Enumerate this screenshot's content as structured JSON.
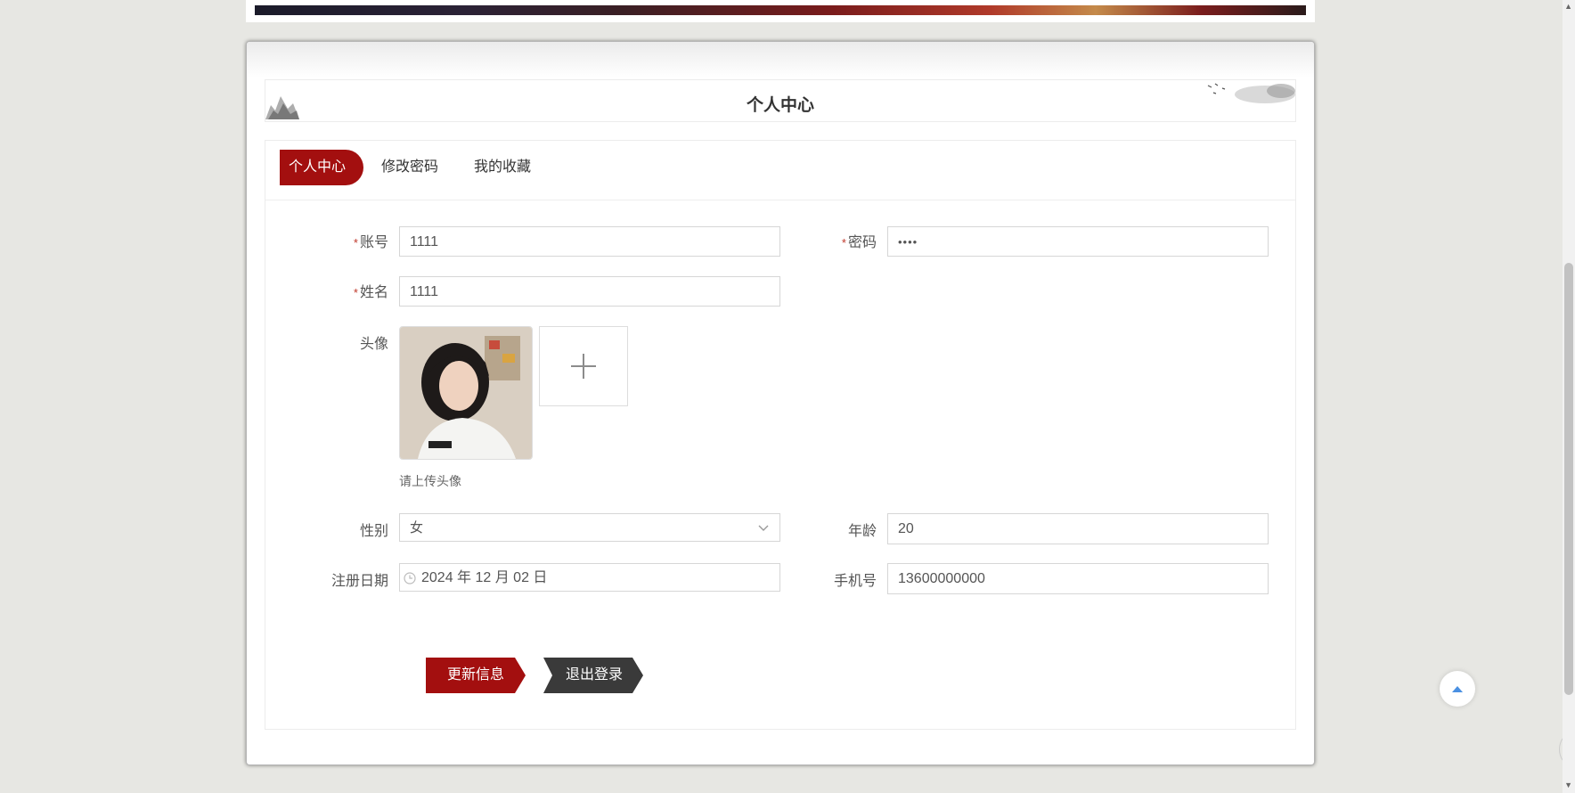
{
  "header": {
    "title": "个人中心"
  },
  "tabs": [
    {
      "label": "个人中心",
      "active": true
    },
    {
      "label": "修改密码",
      "active": false
    },
    {
      "label": "我的收藏",
      "active": false
    }
  ],
  "form": {
    "account": {
      "label": "账号",
      "required": "*",
      "value": "1111"
    },
    "password": {
      "label": "密码",
      "required": "*",
      "value": "••••"
    },
    "name": {
      "label": "姓名",
      "required": "*",
      "value": "1111"
    },
    "avatar": {
      "label": "头像",
      "hint": "请上传头像"
    },
    "gender": {
      "label": "性别",
      "value": "女"
    },
    "age": {
      "label": "年龄",
      "value": "20"
    },
    "register_date": {
      "label": "注册日期",
      "value": "2024 年 12 月 02 日"
    },
    "phone": {
      "label": "手机号",
      "value": "13600000000"
    }
  },
  "buttons": {
    "update": "更新信息",
    "logout": "退出登录"
  },
  "colors": {
    "accent": "#a30f0f",
    "dark_button": "#3a3a3a",
    "back_top_arrow": "#4a90e2"
  }
}
